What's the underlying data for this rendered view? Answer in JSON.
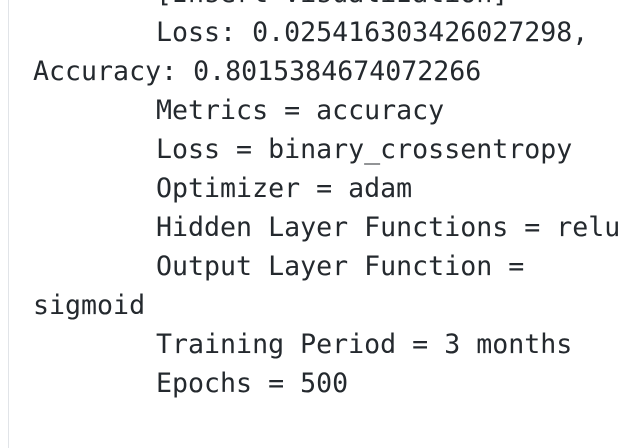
{
  "code_block": {
    "lines": [
      "[Insert Visualization]",
      "Loss: 0.025416303426027298,",
      "Accuracy: 0.8015384674072266",
      "Metrics = accuracy",
      "Loss = binary_crossentropy",
      "Optimizer = adam",
      "Hidden Layer Functions = relu",
      "Output Layer Function =",
      "sigmoid",
      "Training Period = 3 months",
      "Epochs = 500"
    ]
  }
}
